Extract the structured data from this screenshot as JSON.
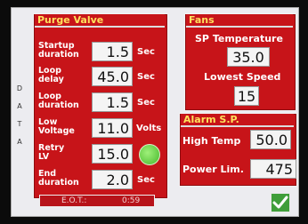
{
  "sidebar": {
    "tab_label": "D A T A"
  },
  "purge_valve": {
    "title": "Purge Valve",
    "rows": [
      {
        "label": "Startup\nduration",
        "value": "1.5",
        "unit": "Sec"
      },
      {
        "label": "Loop\ndelay",
        "value": "45.0",
        "unit": "Sec"
      },
      {
        "label": "Loop\nduration",
        "value": "1.5",
        "unit": "Sec"
      },
      {
        "label": "Low\nVoltage",
        "value": "11.0",
        "unit": "Volts"
      },
      {
        "label": "Retry\nLV",
        "value": "15.0",
        "unit": ""
      },
      {
        "label": "End\nduration",
        "value": "2.0",
        "unit": "Sec"
      }
    ]
  },
  "fans": {
    "title": "Fans",
    "sp_temperature_label": "SP Temperature",
    "sp_temperature_value": "35.0",
    "lowest_speed_label": "Lowest Speed",
    "lowest_speed_value": "15"
  },
  "alarm": {
    "title": "Alarm S.P.",
    "high_temp_label": "High Temp",
    "high_temp_value": "50.0",
    "power_lim_label": "Power Lim.",
    "power_lim_value": "475"
  },
  "footer": {
    "eot_label": "E.O.T.:",
    "eot_time": "0:59"
  },
  "colors": {
    "panel_red": "#c71419",
    "title_yellow": "#ffe15c",
    "ok_green": "#3f9e3a",
    "led_green": "#62cc3a"
  },
  "icons": {
    "ok": "check-icon",
    "status": "status-led-icon"
  }
}
